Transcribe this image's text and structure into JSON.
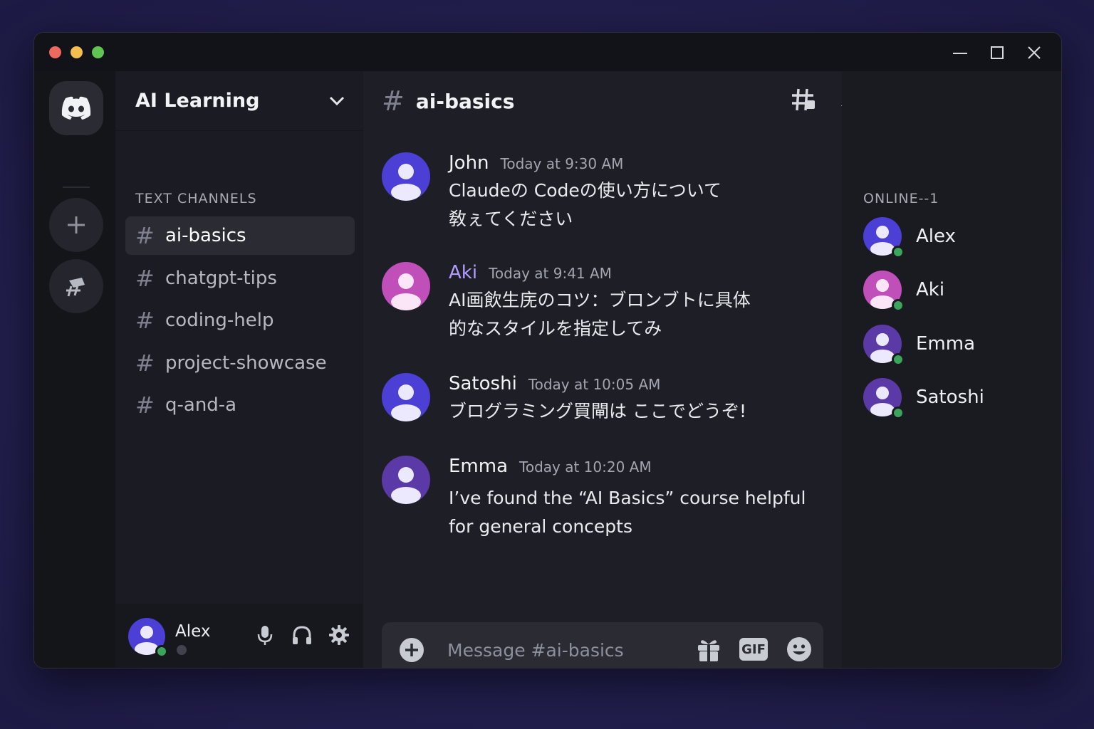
{
  "window": {
    "traffic_colors": [
      "#ed6a5e",
      "#f4bf4f",
      "#61c554"
    ]
  },
  "rail": {
    "servers": [
      {
        "name": "discord-icon",
        "color": "#2a2b33"
      },
      {
        "name": "add-server-icon",
        "color": "#24252d"
      },
      {
        "name": "explore-icon",
        "color": "#24252d"
      }
    ]
  },
  "sidebar": {
    "server_name": "AI Learning",
    "category": "TEXT CHANNELS",
    "channels": [
      {
        "label": "ai-basics",
        "active": true
      },
      {
        "label": "chatgpt-tips",
        "active": false
      },
      {
        "label": "coding-help",
        "active": false
      },
      {
        "label": "project-showcase",
        "active": false
      },
      {
        "label": "q-and-a",
        "active": false
      }
    ]
  },
  "user_panel": {
    "name": "Alex"
  },
  "chat": {
    "channel_title": "ai-basics",
    "messages": [
      {
        "author": "John",
        "time": "Today at 9:30 AM",
        "line1": "Claudeの Codeの使い方について",
        "line2": "敎ぇてください",
        "avatar_color": "#4b3fd6",
        "author_color": "#f2f3f5"
      },
      {
        "author": "Aki",
        "time": "Today at 9:41 AM",
        "line1": "AI画飲生庑のコツ：ブロンブトに具体",
        "line2": "的なスタイルを指定してみ",
        "avatar_color": "#c14fb9",
        "author_color": "#b49cff"
      },
      {
        "author": "Satoshi",
        "time": "Today at 10:05 AM",
        "line1": "ブログラミング買閘は ここでどうぞ!",
        "line2": "",
        "avatar_color": "#4b3fd6",
        "author_color": "#f2f3f5"
      },
      {
        "author": "Emma",
        "time": "Today at 10:20 AM",
        "line1": "I’ve found the “AI Basics” course helpful",
        "line2": "for general concepts",
        "avatar_color": "#5b3aa8",
        "author_color": "#f2f3f5"
      }
    ],
    "composer_placeholder": "Message #ai-basics",
    "gif_label": "GIF"
  },
  "members": {
    "label": "ONLINE--1",
    "list": [
      {
        "name": "Alex",
        "avatar_color": "#4b3fd6"
      },
      {
        "name": "Aki",
        "avatar_color": "#c14fb9"
      },
      {
        "name": "Emma",
        "avatar_color": "#5b3aa8"
      },
      {
        "name": "Satoshi",
        "avatar_color": "#5b3aa8"
      }
    ]
  },
  "colors": {
    "online": "#3ba55c",
    "accent": "#5865f2"
  }
}
